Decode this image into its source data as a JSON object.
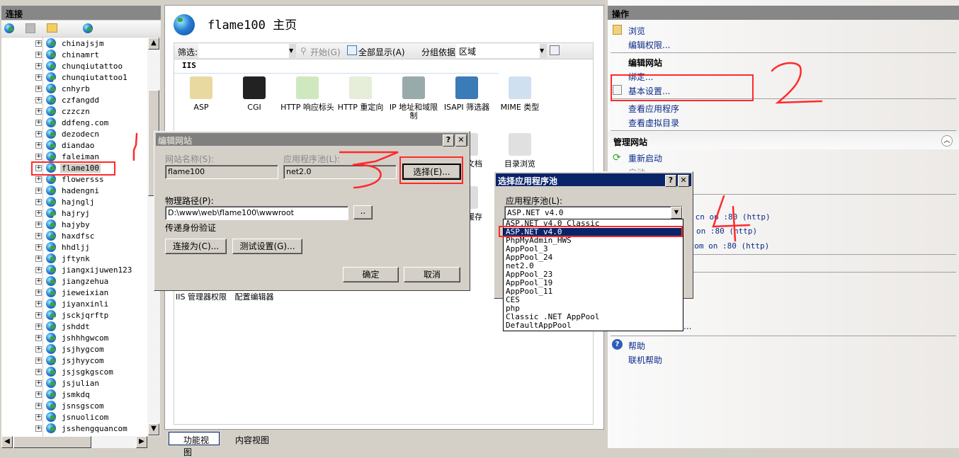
{
  "connections": {
    "title": "连接",
    "tree": [
      {
        "name": "chinajsjm"
      },
      {
        "name": "chinamrt"
      },
      {
        "name": "chunqiutattoo"
      },
      {
        "name": "chunqiutattoo1",
        "stopped": true
      },
      {
        "name": "cnhyrb"
      },
      {
        "name": "czfangdd"
      },
      {
        "name": "czzczn"
      },
      {
        "name": "ddfeng.com"
      },
      {
        "name": "dezodecn"
      },
      {
        "name": "diandao"
      },
      {
        "name": "faleiman"
      },
      {
        "name": "flame100",
        "selected": true
      },
      {
        "name": "flowersss"
      },
      {
        "name": "hadengni"
      },
      {
        "name": "hajnglj"
      },
      {
        "name": "hajryj",
        "stopped": true
      },
      {
        "name": "hajyby"
      },
      {
        "name": "haxdfsc"
      },
      {
        "name": "hhdljj"
      },
      {
        "name": "jftynk"
      },
      {
        "name": "jiangxijuwen123"
      },
      {
        "name": "jiangzehua"
      },
      {
        "name": "jieweixian"
      },
      {
        "name": "jiyanxinli"
      },
      {
        "name": "jsckjqrftp",
        "stopped": true
      },
      {
        "name": "jshddt"
      },
      {
        "name": "jshhhgwcom"
      },
      {
        "name": "jsjhygcom"
      },
      {
        "name": "jsjhyycom"
      },
      {
        "name": "jsjsgkgscom"
      },
      {
        "name": "jsjulian"
      },
      {
        "name": "jsmkdq"
      },
      {
        "name": "jsnsgscom"
      },
      {
        "name": "jsnuolicom"
      },
      {
        "name": "jsshengquancom"
      }
    ]
  },
  "main": {
    "title": "flame100 主页",
    "filter_label": "筛选:",
    "filter_value": "",
    "go_label": "开始(G)",
    "show_all_label": "全部显示(A)",
    "group_by_label": "分组依据:",
    "group_by_value": "区域",
    "section": "IIS",
    "features": [
      {
        "label": "ASP",
        "color": "#e8d9a0"
      },
      {
        "label": "CGI",
        "color": "#222"
      },
      {
        "label": "HTTP 响应标头",
        "color": "#cfe8c0"
      },
      {
        "label": "HTTP 重定向",
        "color": "#e6edd8"
      },
      {
        "label": "IP 地址和域限制",
        "color": "#9aa"
      },
      {
        "label": "ISAPI 筛选器",
        "color": "#3a7bb8"
      },
      {
        "label": "MIME 类型",
        "color": "#cfe0f0"
      },
      {
        "label": "默认文档",
        "color": "#ddd"
      },
      {
        "label": "目录浏览",
        "color": "#e0e0e0"
      },
      {
        "label": "输出缓存",
        "color": "#ddd"
      },
      {
        "label": "IIS 管理器权限",
        "color": "#fff"
      },
      {
        "label": "配置编辑器",
        "color": "#fff"
      }
    ],
    "tabs": [
      {
        "label": "功能视图"
      },
      {
        "label": "内容视图"
      }
    ]
  },
  "actions": {
    "title": "操作",
    "browse": "浏览",
    "edit_permissions": "编辑权限...",
    "edit_site": "编辑网站",
    "bindings": "绑定...",
    "basic_settings": "基本设置...",
    "view_apps": "查看应用程序",
    "view_vdirs": "查看虚拟目录",
    "manage_site": "管理网站",
    "restart": "重新启动",
    "start": "启动",
    "browse_links": [
      "103.996h.cn on :80 (http)",
      "on :80 (http)",
      ".com on :80 (http)"
    ],
    "advanced": "...",
    "help": "帮助",
    "online_help": "联机帮助"
  },
  "edit_site_dialog": {
    "title": "编辑网站",
    "site_name_label": "网站名称(S):",
    "site_name": "flame100",
    "app_pool_label": "应用程序池(L):",
    "app_pool": "net2.0",
    "select_button": "选择(E)...",
    "physical_path_label": "物理路径(P):",
    "physical_path": "D:\\www\\web\\flame100\\wwwroot",
    "browse_button": "..",
    "pass_through_label": "传递身份验证",
    "connect_as_button": "连接为(C)...",
    "test_settings_button": "测试设置(G)...",
    "ok_button": "确定",
    "cancel_button": "取消"
  },
  "select_pool_dialog": {
    "title": "选择应用程序池",
    "pool_label": "应用程序池(L):",
    "selected": "ASP.NET v4.0",
    "options": [
      "ASP.NET v4.0 Classic",
      "ASP.NET v4.0",
      "PhpMyAdmin_HWS",
      "AppPool_3",
      "AppPool_24",
      "net2.0",
      "AppPool_23",
      "AppPool_19",
      "AppPool_11",
      "CES",
      "php",
      "Classic .NET AppPool",
      "DefaultAppPool"
    ],
    "highlighted_index": 1
  },
  "annotations": {
    "color": "#ff2a2a",
    "numbers": [
      "1",
      "2",
      "3",
      "4"
    ]
  }
}
